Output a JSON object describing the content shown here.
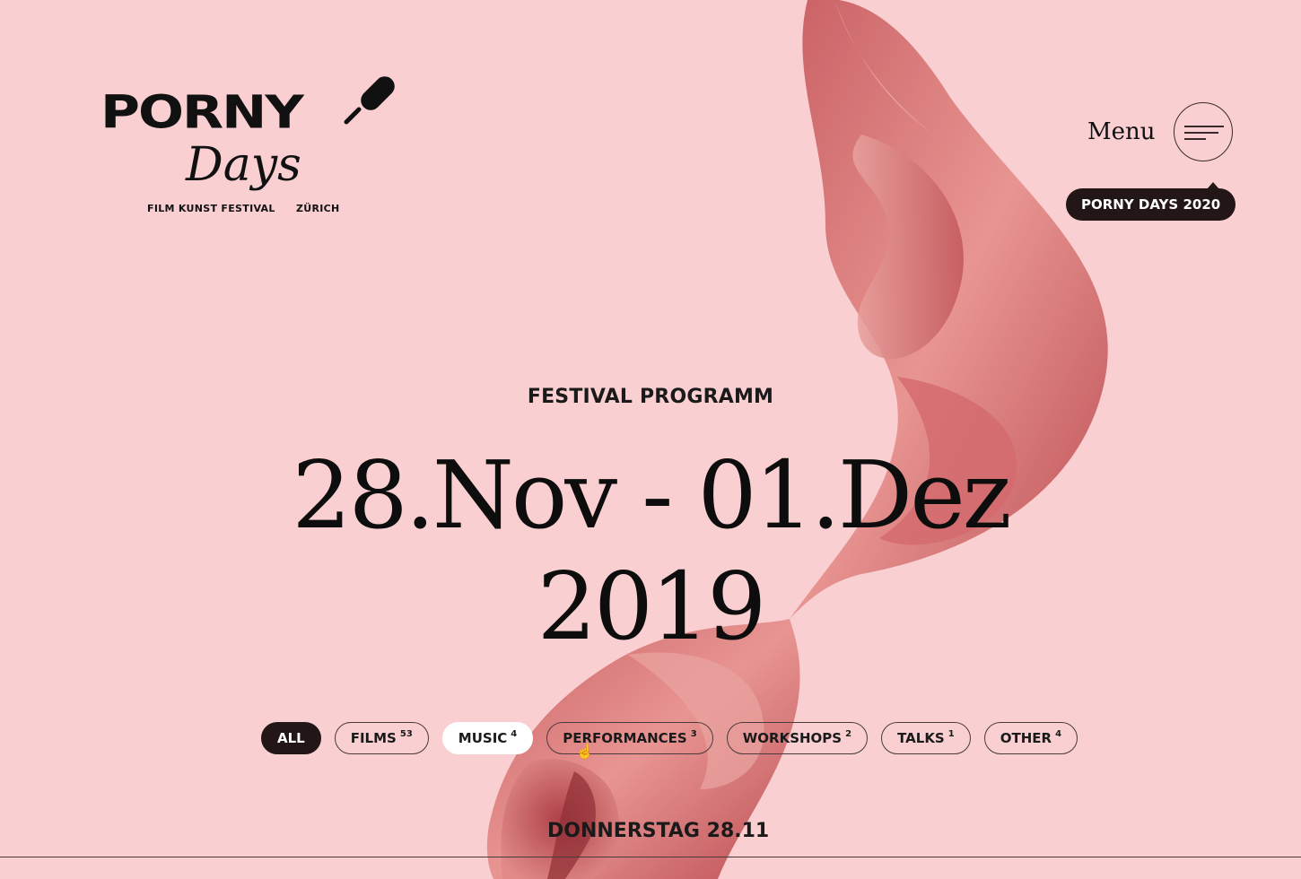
{
  "logo": {
    "word": "PORNY",
    "script": "Days",
    "sub_left": "FILM KUNST FESTIVAL",
    "sub_right": "ZÜRICH",
    "mic_icon": "microphone-icon"
  },
  "menu": {
    "label": "Menu",
    "icon": "hamburger-icon"
  },
  "year_badge": "PORNY DAYS 2020",
  "hero": {
    "kicker": "FESTIVAL PROGRAMM",
    "dates_line1": "28.Nov - 01.Dez",
    "dates_line2": "2019"
  },
  "filters": [
    {
      "label": "ALL",
      "count": "",
      "state": "active"
    },
    {
      "label": "FILMS",
      "count": "53",
      "state": "normal"
    },
    {
      "label": "MUSIC",
      "count": "4",
      "state": "light"
    },
    {
      "label": "PERFORMANCES",
      "count": "3",
      "state": "normal"
    },
    {
      "label": "WORKSHOPS",
      "count": "2",
      "state": "normal"
    },
    {
      "label": "TALKS",
      "count": "1",
      "state": "normal"
    },
    {
      "label": "OTHER",
      "count": "4",
      "state": "normal"
    }
  ],
  "day_heading": "DONNERSTAG 28.11",
  "colors": {
    "background": "#f9cfd1",
    "swirl": "#d9777a",
    "dark": "#221617"
  }
}
